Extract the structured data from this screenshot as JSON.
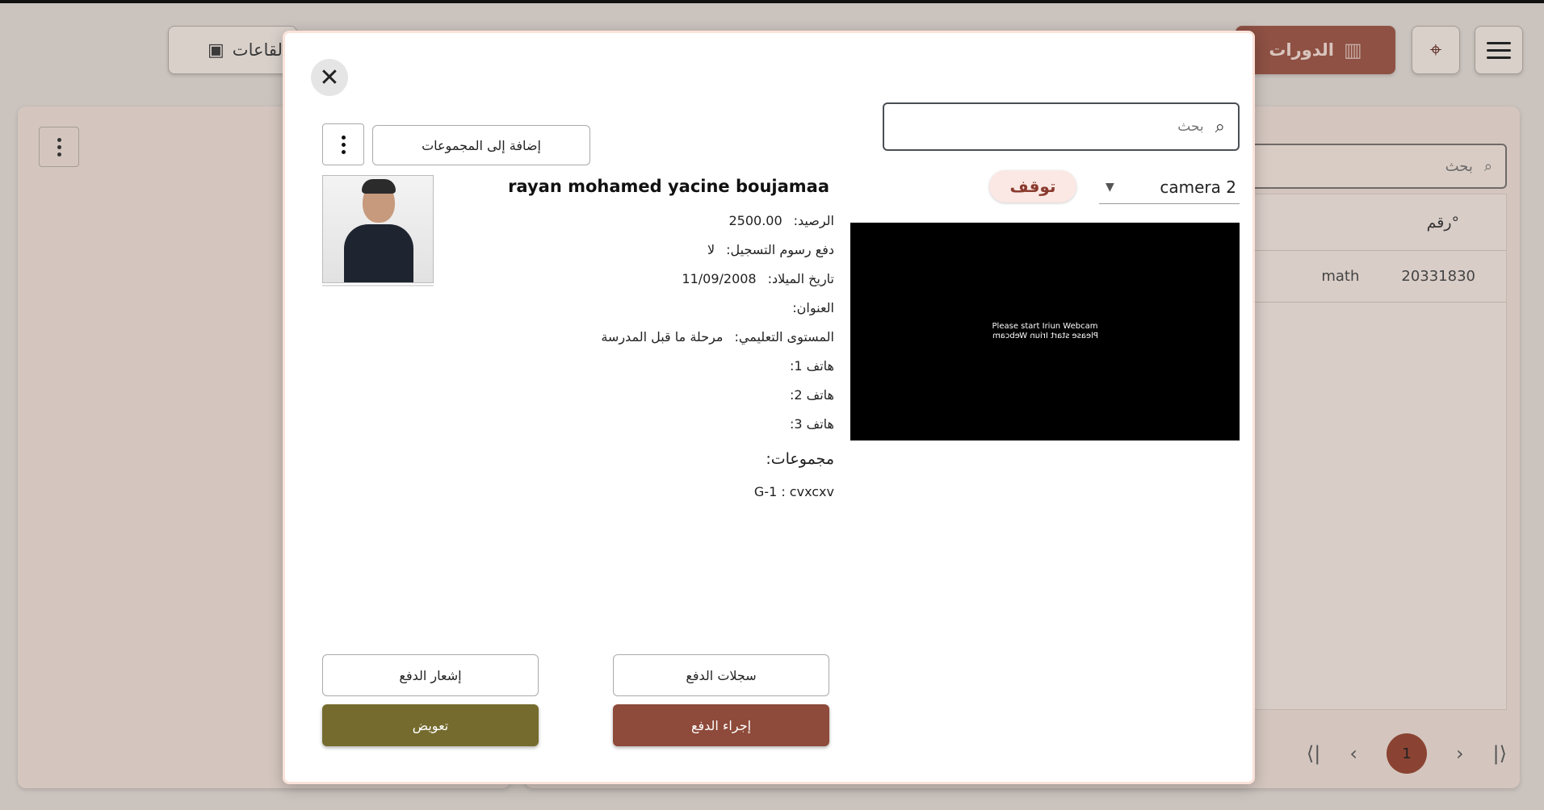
{
  "app": {
    "courses_label": "الدورات",
    "halls_label": "القاعات",
    "search_placeholder": "بحث",
    "table": {
      "header": "رقم°",
      "rows": [
        {
          "subject": "math",
          "number": "20331830"
        }
      ]
    },
    "pagination": {
      "current_page": "1",
      "first": "⟨|",
      "prev": "‹",
      "next": "›",
      "last": "|⟩"
    }
  },
  "modal": {
    "search_placeholder": "بحث",
    "camera": {
      "selected": "camera 2",
      "stop_label": "توقف",
      "message": "Please start Iriun Webcam"
    },
    "add_to_groups_label": "إضافة إلى المجموعات",
    "student": {
      "name": "rayan mohamed yacine boujamaa",
      "balance_label": "الرصيد:",
      "balance_value": "2500.00",
      "registration_fee_label": "دفع رسوم التسجيل:",
      "registration_fee_value": "لا",
      "birthdate_label": "تاريخ الميلاد:",
      "birthdate_value": "11/09/2008",
      "address_label": "العنوان:",
      "level_label": "المستوى التعليمي:",
      "level_value": "مرحلة ما قبل المدرسة",
      "phone1_label": "هاتف 1:",
      "phone2_label": "هاتف 2:",
      "phone3_label": "هاتف 3:",
      "groups_label": "مجموعات:",
      "groups": [
        "G-1 : cvxcxv"
      ]
    },
    "buttons": {
      "payment_notice": "إشعار الدفع",
      "payment_records": "سجلات الدفع",
      "compensation": "تعويض",
      "make_payment": "إجراء الدفع"
    }
  },
  "colors": {
    "accent_brown": "#8e4a3a",
    "accent_olive": "#756b2e",
    "stop_bg": "#fbe8e4"
  }
}
